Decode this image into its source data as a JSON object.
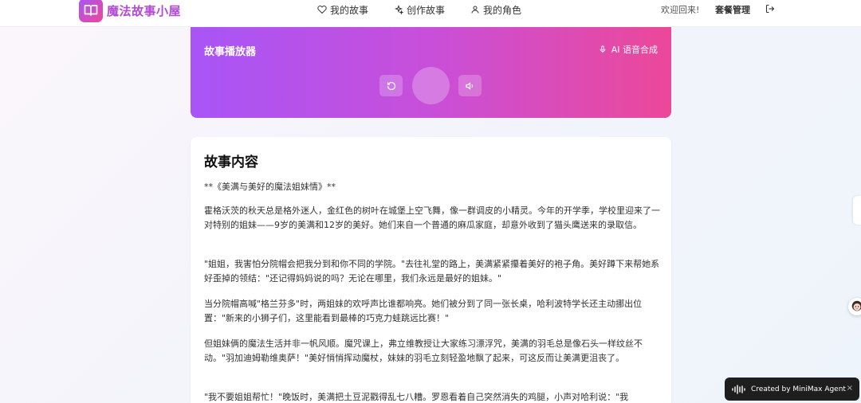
{
  "header": {
    "app_name": "魔法故事小屋",
    "nav": [
      {
        "label": "我的故事",
        "icon": "heart-icon"
      },
      {
        "label": "创作故事",
        "icon": "sparkles-icon"
      },
      {
        "label": "我的角色",
        "icon": "user-icon"
      }
    ],
    "welcome": "欢迎回来!",
    "plan_label": "套餐管理",
    "logout_icon": "logout-icon"
  },
  "player": {
    "title": "故事播放器",
    "ai_label": "AI 语音合成",
    "gradient": [
      "#a855f7",
      "#ec4899"
    ]
  },
  "content": {
    "title": "故事内容",
    "paragraphs": [
      "**《美满与美好的魔法姐妹情》**",
      "霍格沃茨的秋天总是格外迷人，金红色的树叶在城堡上空飞舞，像一群调皮的小精灵。今年的开学季，学校里迎来了一对特别的姐妹——9岁的美满和12岁的美好。她们来自一个普通的麻瓜家庭，却意外收到了猫头鹰送来的录取信。",
      "\"姐姐，我害怕分院帽会把我分到和你不同的学院。\"去往礼堂的路上，美满紧紧攥着美好的袍子角。美好蹲下来帮她系好歪掉的领结：\"还记得妈妈说的吗？无论在哪里，我们永远是最好的姐妹。\"",
      "当分院帽高喊\"格兰芬多\"时，两姐妹的欢呼声比谁都响亮。她们被分到了同一张长桌，哈利波特学长还主动挪出位置：\"新来的小狮子们，这里能看到最棒的巧克力蛙跳远比赛！\"",
      "但姐妹俩的魔法生活并非一帆风顺。魔咒课上，弗立维教授让大家练习漂浮咒，美满的羽毛总是像石头一样纹丝不动。\"羽加迪姆勒维奥萨！\"美好悄悄挥动魔杖，妹妹的羽毛立刻轻盈地飘了起来，可这反而让美满更沮丧了。",
      "\"我不要姐姐帮忙！\"晚饭时，美满把土豆泥戳得乱七八糟。罗恩看着自己突然消失的鸡腿，小声对哈利说：\"我"
    ]
  },
  "badge": {
    "label": "Created by MiniMax Agent",
    "close": "×"
  }
}
